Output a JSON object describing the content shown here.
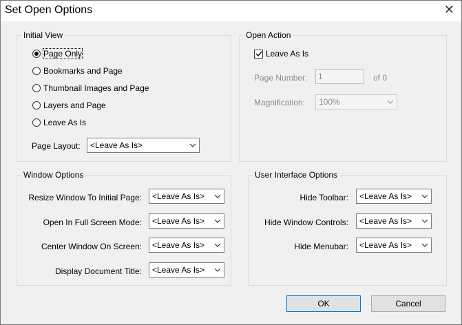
{
  "window": {
    "title": "Set Open Options",
    "close": "✕"
  },
  "initial_view": {
    "group_label": "Initial View",
    "options": [
      {
        "label": "Page Only",
        "selected": true
      },
      {
        "label": "Bookmarks and Page",
        "selected": false
      },
      {
        "label": "Thumbnail Images and Page",
        "selected": false
      },
      {
        "label": "Layers and Page",
        "selected": false
      },
      {
        "label": "Leave As Is",
        "selected": false
      }
    ],
    "page_layout_label": "Page Layout:",
    "page_layout_value": "<Leave As Is>"
  },
  "open_action": {
    "group_label": "Open Action",
    "leave_as_is_label": "Leave As Is",
    "leave_as_is_checked": true,
    "page_number_label": "Page Number:",
    "page_number_value": "1",
    "of_text": "of 0",
    "magnification_label": "Magnification:",
    "magnification_value": "100%"
  },
  "window_options": {
    "group_label": "Window Options",
    "rows": [
      {
        "label": "Resize Window To Initial Page:",
        "value": "<Leave As Is>"
      },
      {
        "label": "Open In Full Screen Mode:",
        "value": "<Leave As Is>"
      },
      {
        "label": "Center Window On Screen:",
        "value": "<Leave As Is>"
      },
      {
        "label": "Display Document Title:",
        "value": "<Leave As Is>"
      }
    ]
  },
  "ui_options": {
    "group_label": "User Interface Options",
    "rows": [
      {
        "label": "Hide Toolbar:",
        "value": "<Leave As Is>"
      },
      {
        "label": "Hide Window Controls:",
        "value": "<Leave As Is>"
      },
      {
        "label": "Hide Menubar:",
        "value": "<Leave As Is>"
      }
    ]
  },
  "buttons": {
    "ok": "OK",
    "cancel": "Cancel"
  },
  "icons": {
    "chevron": "chevron-down-icon",
    "check": "checkmark-icon",
    "close": "close-icon"
  }
}
